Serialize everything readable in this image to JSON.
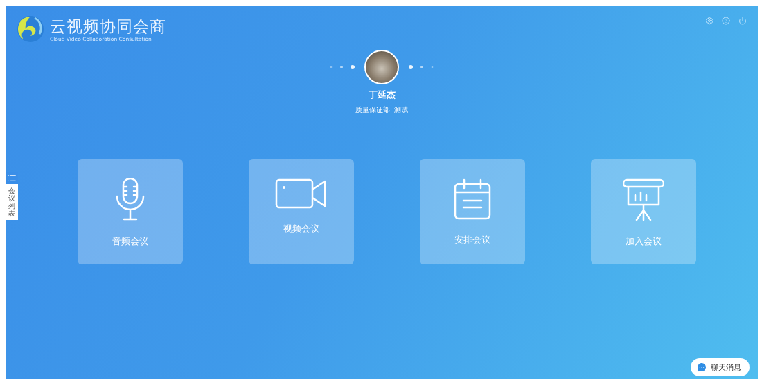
{
  "brand": {
    "title": "云视频协同会商",
    "subtitle": "Cloud Video Collaboration Consultation"
  },
  "user": {
    "name": "丁延杰",
    "department": "质量保证部",
    "role": "测试"
  },
  "side_tab": {
    "label": "会议列表"
  },
  "actions": [
    {
      "kind": "audio",
      "label": "音频会议"
    },
    {
      "kind": "video",
      "label": "视频会议"
    },
    {
      "kind": "schedule",
      "label": "安排会议"
    },
    {
      "kind": "join",
      "label": "加入会议"
    }
  ],
  "chat_button": {
    "label": "聊天消息"
  }
}
